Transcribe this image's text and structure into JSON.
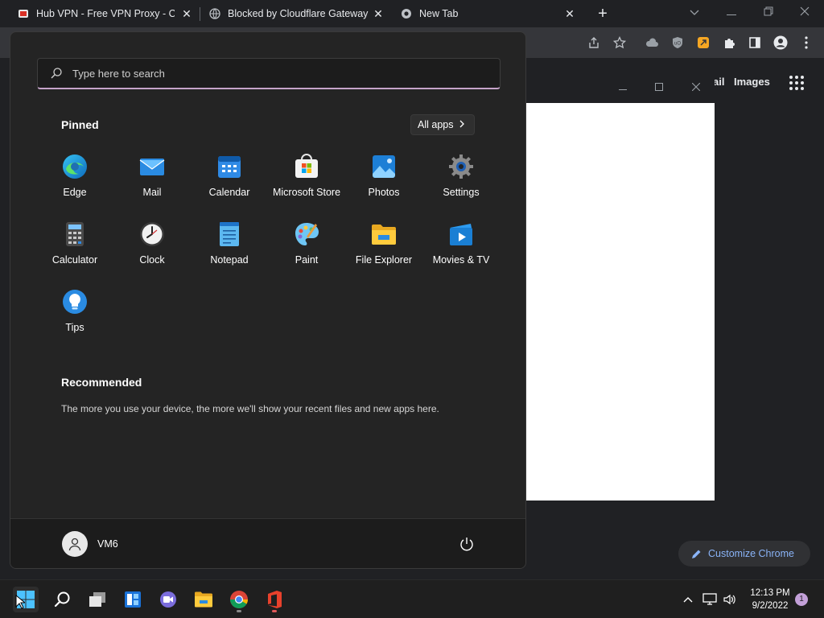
{
  "browser": {
    "tabs": [
      {
        "title": "Hub VPN - Free VPN Proxy - Chr"
      },
      {
        "title": "Blocked by Cloudflare Gateway"
      },
      {
        "title": "New Tab"
      }
    ],
    "close_glyph": "✕",
    "new_tab_glyph": "+"
  },
  "ntp": {
    "link_gmail_partial": "ail",
    "link_images": "Images",
    "customize_label": "Customize Chrome"
  },
  "start_menu": {
    "search_placeholder": "Type here to search",
    "pinned_title": "Pinned",
    "all_apps_label": "All apps",
    "pinned_apps": [
      {
        "label": "Edge",
        "icon": "edge-icon"
      },
      {
        "label": "Mail",
        "icon": "mail-icon"
      },
      {
        "label": "Calendar",
        "icon": "calendar-icon"
      },
      {
        "label": "Microsoft Store",
        "icon": "store-icon"
      },
      {
        "label": "Photos",
        "icon": "photos-icon"
      },
      {
        "label": "Settings",
        "icon": "gear-icon"
      },
      {
        "label": "Calculator",
        "icon": "calculator-icon"
      },
      {
        "label": "Clock",
        "icon": "clock-icon"
      },
      {
        "label": "Notepad",
        "icon": "notepad-icon"
      },
      {
        "label": "Paint",
        "icon": "paint-icon"
      },
      {
        "label": "File Explorer",
        "icon": "folder-icon"
      },
      {
        "label": "Movies & TV",
        "icon": "movies-icon"
      },
      {
        "label": "Tips",
        "icon": "lightbulb-icon"
      }
    ],
    "recommended_title": "Recommended",
    "recommended_text": "The more you use your device, the more we'll show your recent files and new apps here.",
    "user_name": "VM6"
  },
  "taskbar": {
    "time": "12:13 PM",
    "date": "9/2/2022",
    "notification_count": "1"
  },
  "colors": {
    "accent": "#8ab4f8",
    "start_bg": "#242424",
    "search_underline": "#c5a3c9"
  }
}
